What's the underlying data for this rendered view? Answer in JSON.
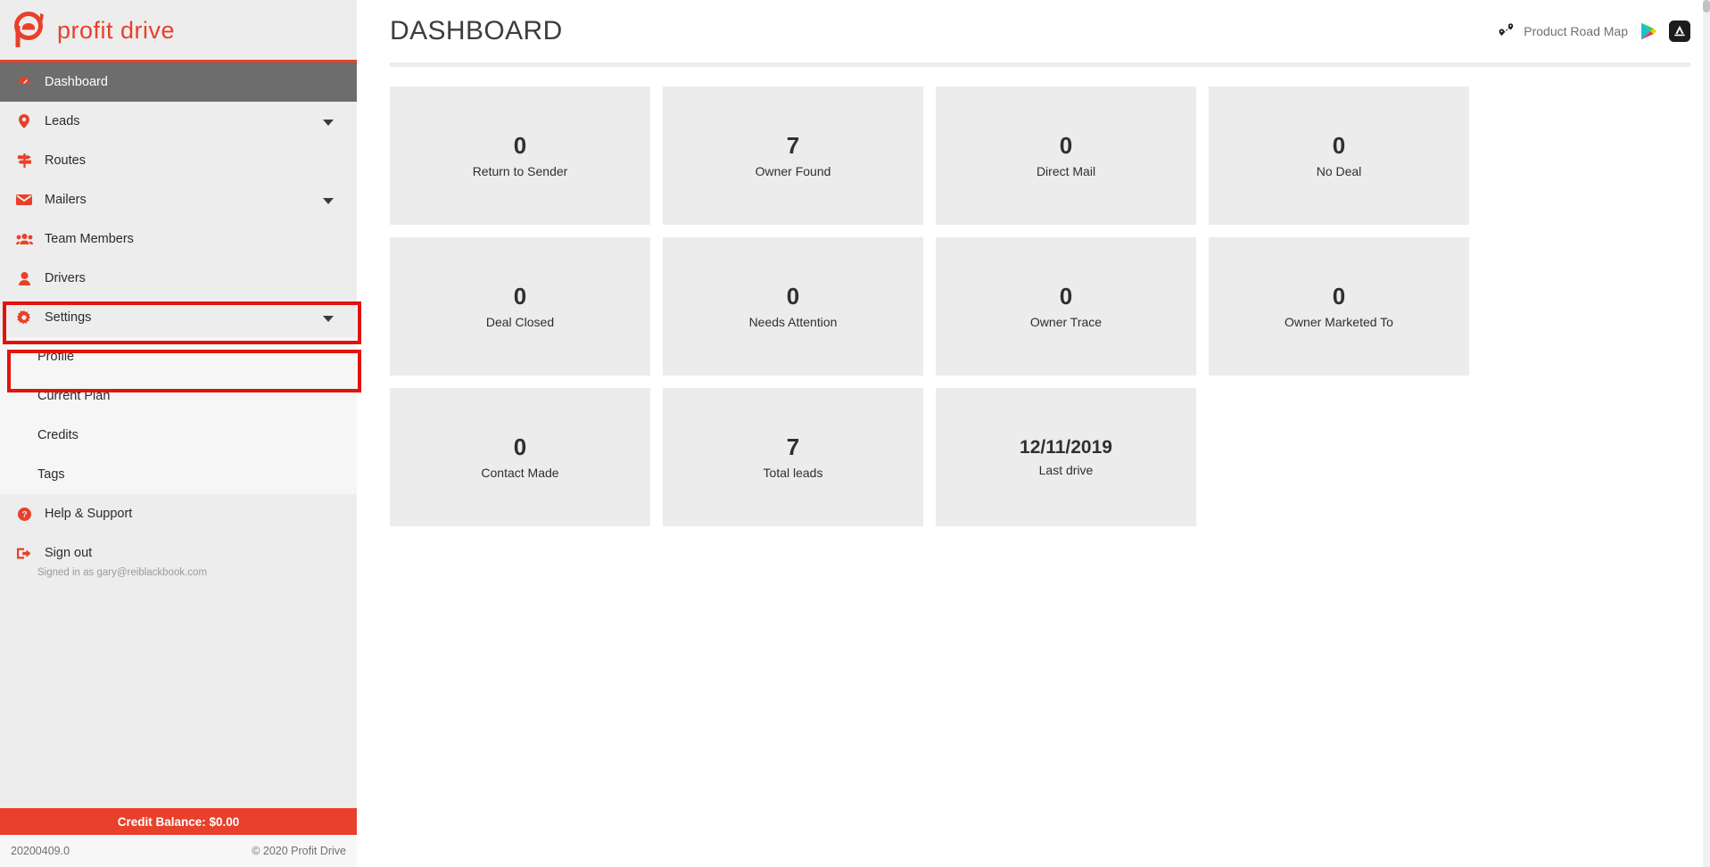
{
  "brand": {
    "name": "profit drive",
    "logo_icon": "profit-drive-logo",
    "accent": "#e8402a"
  },
  "sidebar": {
    "items": [
      {
        "label": "Dashboard",
        "icon": "dashboard-gauge-icon",
        "active": true,
        "caret": false
      },
      {
        "label": "Leads",
        "icon": "map-pin-icon",
        "active": false,
        "caret": true
      },
      {
        "label": "Routes",
        "icon": "signpost-icon",
        "active": false,
        "caret": false
      },
      {
        "label": "Mailers",
        "icon": "envelope-icon",
        "active": false,
        "caret": true
      },
      {
        "label": "Team Members",
        "icon": "users-group-icon",
        "active": false,
        "caret": false
      },
      {
        "label": "Drivers",
        "icon": "user-icon",
        "active": false,
        "caret": false
      },
      {
        "label": "Settings",
        "icon": "gear-icon",
        "active": false,
        "caret": true
      }
    ],
    "settings_submenu": [
      {
        "label": "Profile",
        "highlighted": true
      },
      {
        "label": "Current Plan",
        "highlighted": false
      },
      {
        "label": "Credits",
        "highlighted": false
      },
      {
        "label": "Tags",
        "highlighted": false
      }
    ],
    "help": {
      "label": "Help & Support",
      "icon": "question-circle-icon"
    },
    "signout": {
      "label": "Sign out",
      "icon": "sign-out-icon"
    },
    "signed_in_as": "Signed in as gary@reiblackbook.com",
    "credit_balance": "Credit Balance: $0.00",
    "version": "20200409.0",
    "copyright": "© 2020 Profit Drive"
  },
  "header": {
    "title": "DASHBOARD",
    "roadmap_label": "Product Road Map",
    "roadmap_icon": "route-pins-icon",
    "play_store_icon": "google-play-icon",
    "app_store_icon": "apple-app-store-icon"
  },
  "cards": [
    {
      "value": "0",
      "label": "Return to Sender",
      "kind": "number"
    },
    {
      "value": "7",
      "label": "Owner Found",
      "kind": "number"
    },
    {
      "value": "0",
      "label": "Direct Mail",
      "kind": "number"
    },
    {
      "value": "0",
      "label": "No Deal",
      "kind": "number"
    },
    {
      "value": "0",
      "label": "Deal Closed",
      "kind": "number"
    },
    {
      "value": "0",
      "label": "Needs Attention",
      "kind": "number"
    },
    {
      "value": "0",
      "label": "Owner Trace",
      "kind": "number"
    },
    {
      "value": "0",
      "label": "Owner Marketed To",
      "kind": "number"
    },
    {
      "value": "0",
      "label": "Contact Made",
      "kind": "number"
    },
    {
      "value": "7",
      "label": "Total leads",
      "kind": "number"
    },
    {
      "value": "12/11/2019",
      "label": "Last drive",
      "kind": "date"
    }
  ]
}
